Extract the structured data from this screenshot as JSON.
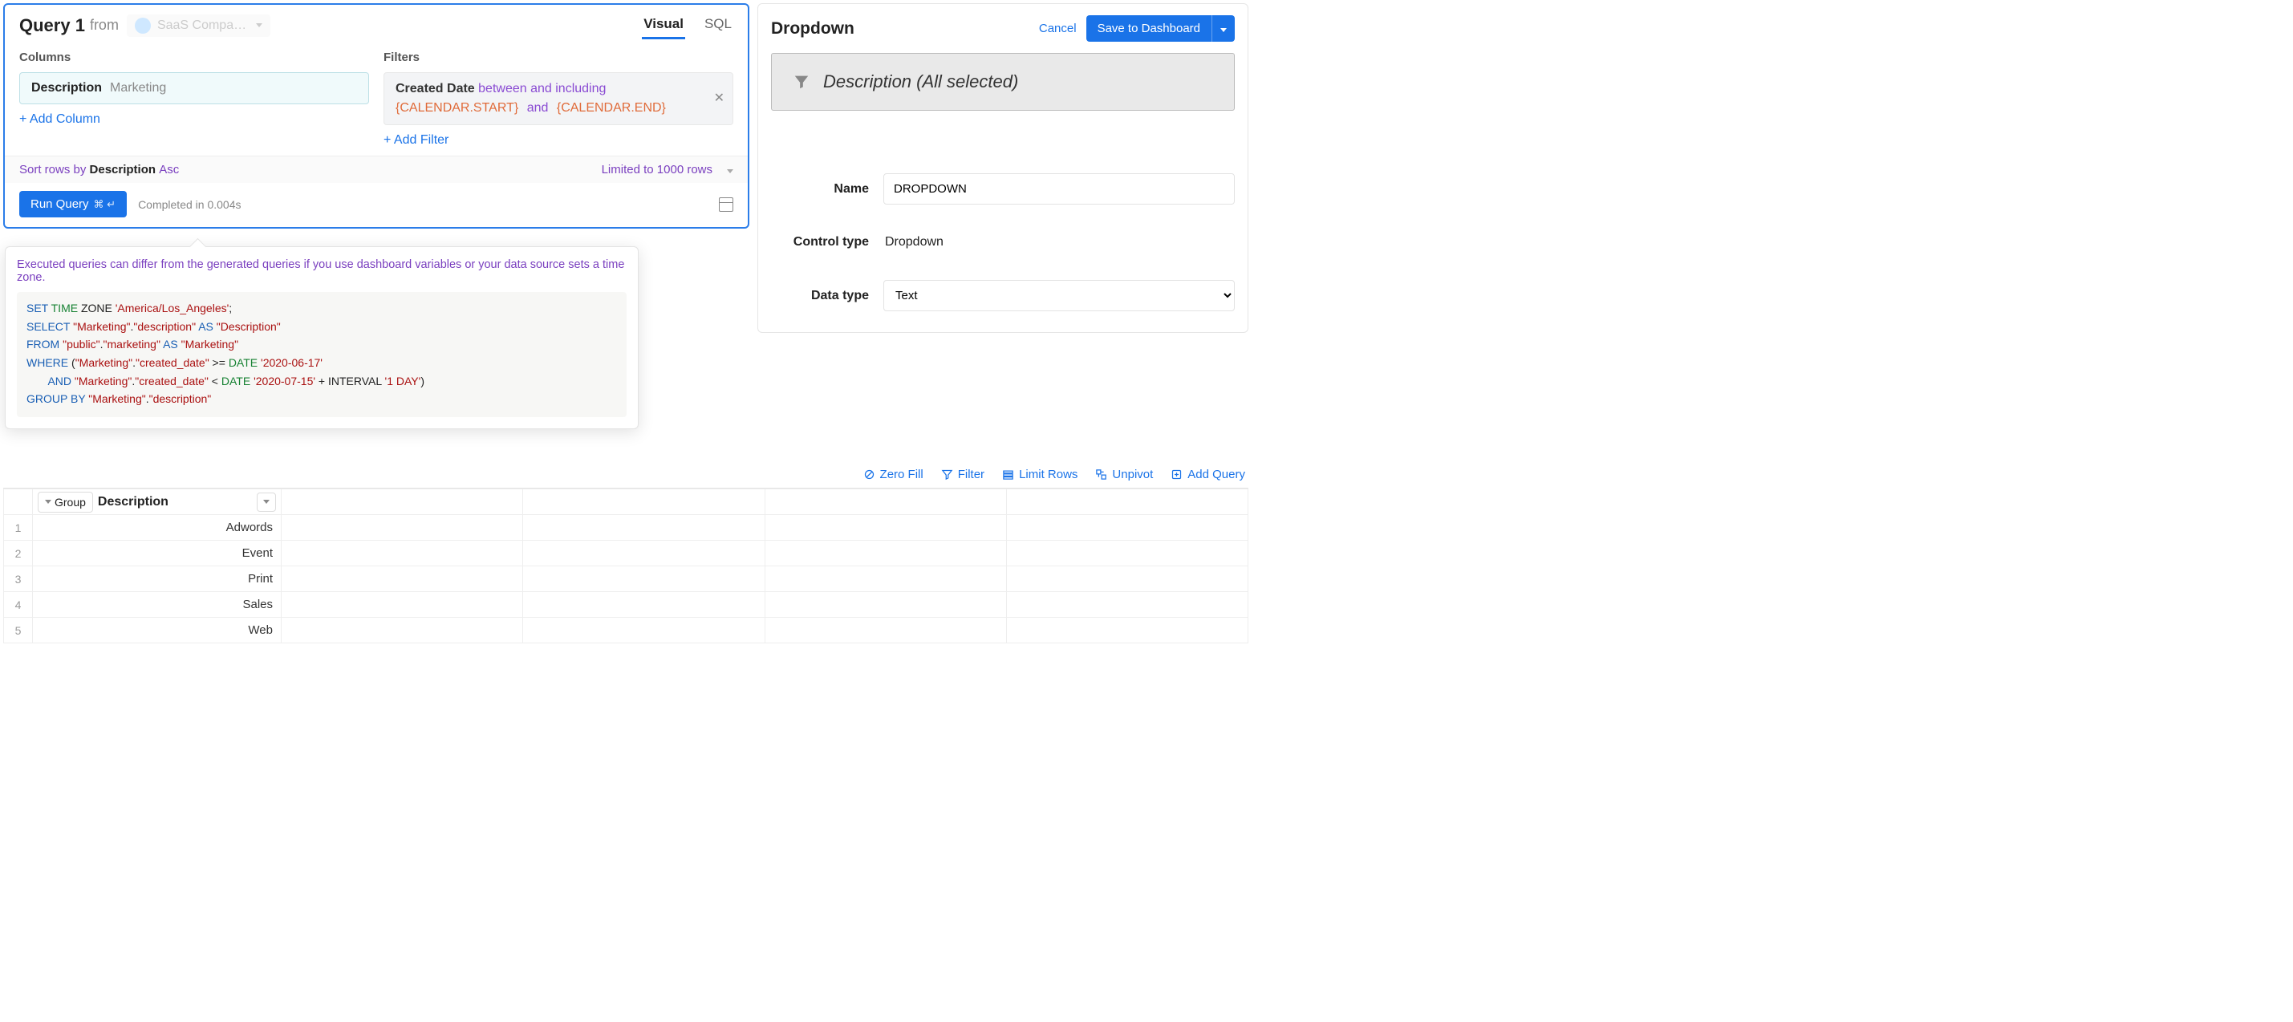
{
  "query_panel": {
    "title": "Query 1",
    "from_label": "from",
    "datasource": "SaaS Compa…",
    "tabs": {
      "visual": "Visual",
      "sql": "SQL"
    },
    "columns_title": "Columns",
    "column_chip": {
      "name": "Description",
      "sub": "Marketing"
    },
    "add_column": "+ Add Column",
    "filters_title": "Filters",
    "filter_chip": {
      "label": "Created Date",
      "op": "between and including",
      "var1": "{CALENDAR.START}",
      "mid": "and",
      "var2": "{CALENDAR.END}"
    },
    "add_filter": "+ Add Filter",
    "sort": {
      "prefix": "Sort rows by",
      "col": "Description",
      "dir": "Asc"
    },
    "limit": "Limited to 1000 rows",
    "run_button": "Run Query",
    "run_shortcut": "⌘ ↵",
    "completed": "Completed in 0.004s"
  },
  "sql_popup": {
    "note": "Executed queries can differ from the generated queries if you use dashboard variables or your data source sets a time zone.",
    "tokens": [
      {
        "c": "kw",
        "t": "SET"
      },
      {
        "c": "pl",
        "t": " "
      },
      {
        "c": "fn",
        "t": "TIME"
      },
      {
        "c": "pl",
        "t": " ZONE "
      },
      {
        "c": "id",
        "t": "'America/Los_Angeles'"
      },
      {
        "c": "pl",
        "t": ";\n"
      },
      {
        "c": "kw",
        "t": "SELECT"
      },
      {
        "c": "pl",
        "t": " "
      },
      {
        "c": "id",
        "t": "\"Marketing\""
      },
      {
        "c": "pl",
        "t": "."
      },
      {
        "c": "id",
        "t": "\"description\""
      },
      {
        "c": "pl",
        "t": " "
      },
      {
        "c": "kw",
        "t": "AS"
      },
      {
        "c": "pl",
        "t": " "
      },
      {
        "c": "id",
        "t": "\"Description\""
      },
      {
        "c": "pl",
        "t": "\n"
      },
      {
        "c": "kw",
        "t": "FROM"
      },
      {
        "c": "pl",
        "t": " "
      },
      {
        "c": "id",
        "t": "\"public\""
      },
      {
        "c": "pl",
        "t": "."
      },
      {
        "c": "id",
        "t": "\"marketing\""
      },
      {
        "c": "pl",
        "t": " "
      },
      {
        "c": "kw",
        "t": "AS"
      },
      {
        "c": "pl",
        "t": " "
      },
      {
        "c": "id",
        "t": "\"Marketing\""
      },
      {
        "c": "pl",
        "t": "\n"
      },
      {
        "c": "kw",
        "t": "WHERE"
      },
      {
        "c": "pl",
        "t": " ("
      },
      {
        "c": "id",
        "t": "\"Marketing\""
      },
      {
        "c": "pl",
        "t": "."
      },
      {
        "c": "id",
        "t": "\"created_date\""
      },
      {
        "c": "pl",
        "t": " >= "
      },
      {
        "c": "fn",
        "t": "DATE"
      },
      {
        "c": "pl",
        "t": " "
      },
      {
        "c": "id",
        "t": "'2020-06-17'"
      },
      {
        "c": "pl",
        "t": "\n       "
      },
      {
        "c": "kw",
        "t": "AND"
      },
      {
        "c": "pl",
        "t": " "
      },
      {
        "c": "id",
        "t": "\"Marketing\""
      },
      {
        "c": "pl",
        "t": "."
      },
      {
        "c": "id",
        "t": "\"created_date\""
      },
      {
        "c": "pl",
        "t": " < "
      },
      {
        "c": "fn",
        "t": "DATE"
      },
      {
        "c": "pl",
        "t": " "
      },
      {
        "c": "id",
        "t": "'2020-07-15'"
      },
      {
        "c": "pl",
        "t": " + INTERVAL "
      },
      {
        "c": "id",
        "t": "'1 DAY'"
      },
      {
        "c": "pl",
        "t": ")\n"
      },
      {
        "c": "kw",
        "t": "GROUP BY"
      },
      {
        "c": "pl",
        "t": " "
      },
      {
        "c": "id",
        "t": "\"Marketing\""
      },
      {
        "c": "pl",
        "t": "."
      },
      {
        "c": "id",
        "t": "\"description\""
      }
    ]
  },
  "toolbar": {
    "zero_fill": "Zero Fill",
    "filter": "Filter",
    "limit_rows": "Limit Rows",
    "unpivot": "Unpivot",
    "add_query": "Add Query"
  },
  "results": {
    "group_label": "Group",
    "header": "Description",
    "rows": [
      "Adwords",
      "Event",
      "Print",
      "Sales",
      "Web"
    ]
  },
  "right_panel": {
    "title": "Dropdown",
    "cancel": "Cancel",
    "save": "Save to Dashboard",
    "preview": "Description (All selected)",
    "name_label": "Name",
    "name_value": "DROPDOWN",
    "control_type_label": "Control type",
    "control_type_value": "Dropdown",
    "data_type_label": "Data type",
    "data_type_value": "Text"
  }
}
